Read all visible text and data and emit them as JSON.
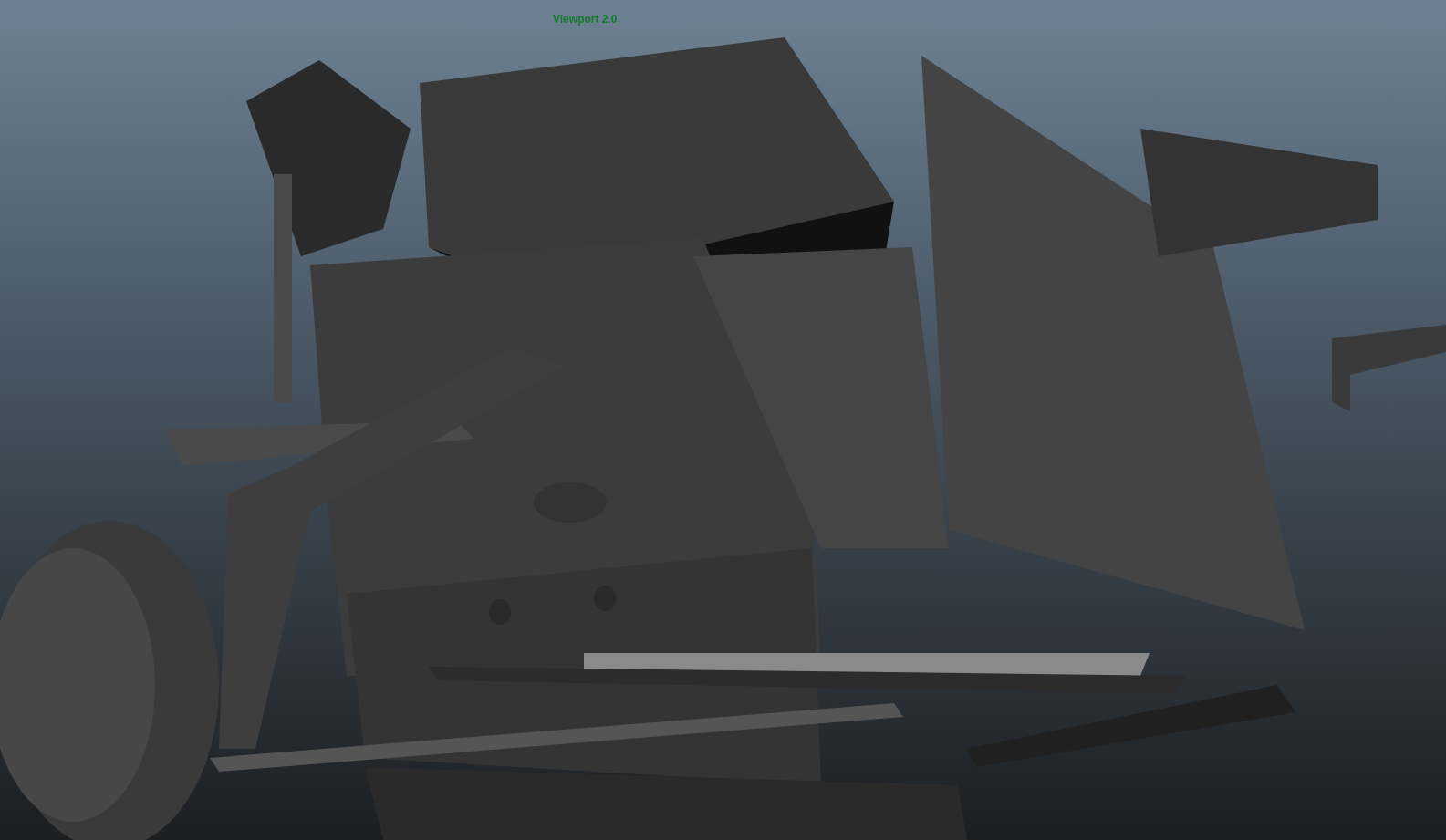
{
  "viewport": {
    "label": "Viewport 2.0"
  }
}
